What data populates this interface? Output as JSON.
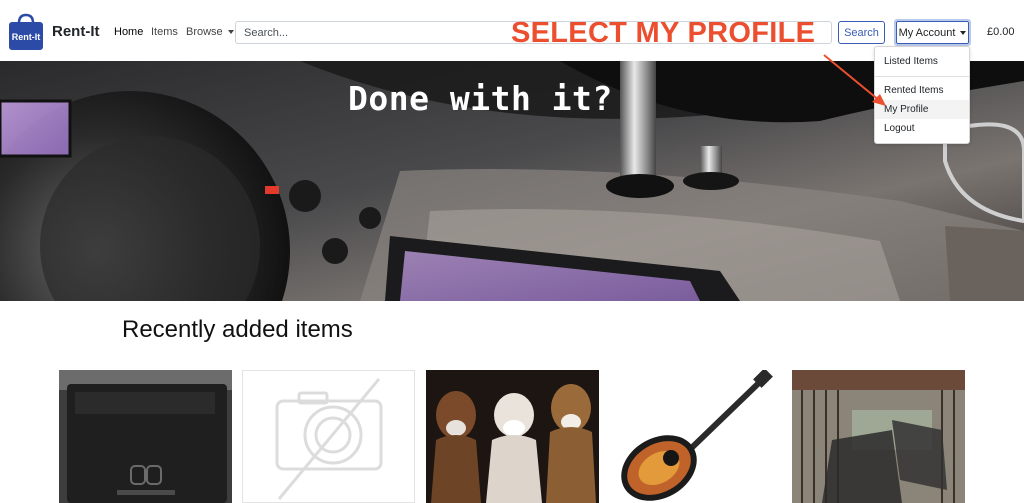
{
  "navbar": {
    "logo_text": "Rent-It",
    "brand": "Rent-It",
    "links": {
      "home": "Home",
      "items": "Items",
      "browse": "Browse"
    },
    "search": {
      "placeholder": "Search...",
      "value": "",
      "button": "Search"
    },
    "account_button": "My Account",
    "cart_total": "£0.00"
  },
  "dropdown": {
    "items": [
      "Listed Items",
      "Rented Items",
      "My Profile",
      "Logout"
    ],
    "highlighted": "My Profile"
  },
  "hero": {
    "title": "Done with it?"
  },
  "annotation": {
    "text": "SELECT MY PROFILE",
    "color": "#ec4f2f"
  },
  "recent": {
    "title": "Recently added items",
    "items": [
      {
        "image": "game-console-dock"
      },
      {
        "image": "no-image-placeholder"
      },
      {
        "image": "three-dogs"
      },
      {
        "image": "acoustic-guitar"
      },
      {
        "image": "balcony-chairs"
      }
    ]
  },
  "colors": {
    "accent": "#3b5bb5",
    "logo": "#2b4ba6"
  }
}
